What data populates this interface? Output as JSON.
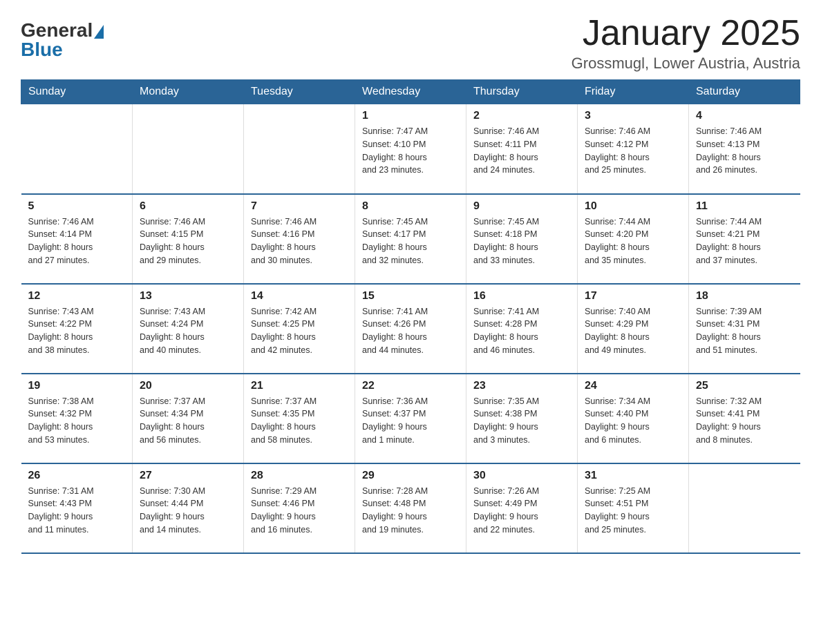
{
  "header": {
    "logo_general": "General",
    "logo_blue": "Blue",
    "title": "January 2025",
    "location": "Grossmugl, Lower Austria, Austria"
  },
  "days_of_week": [
    "Sunday",
    "Monday",
    "Tuesday",
    "Wednesday",
    "Thursday",
    "Friday",
    "Saturday"
  ],
  "weeks": [
    [
      {
        "day": "",
        "info": ""
      },
      {
        "day": "",
        "info": ""
      },
      {
        "day": "",
        "info": ""
      },
      {
        "day": "1",
        "info": "Sunrise: 7:47 AM\nSunset: 4:10 PM\nDaylight: 8 hours\nand 23 minutes."
      },
      {
        "day": "2",
        "info": "Sunrise: 7:46 AM\nSunset: 4:11 PM\nDaylight: 8 hours\nand 24 minutes."
      },
      {
        "day": "3",
        "info": "Sunrise: 7:46 AM\nSunset: 4:12 PM\nDaylight: 8 hours\nand 25 minutes."
      },
      {
        "day": "4",
        "info": "Sunrise: 7:46 AM\nSunset: 4:13 PM\nDaylight: 8 hours\nand 26 minutes."
      }
    ],
    [
      {
        "day": "5",
        "info": "Sunrise: 7:46 AM\nSunset: 4:14 PM\nDaylight: 8 hours\nand 27 minutes."
      },
      {
        "day": "6",
        "info": "Sunrise: 7:46 AM\nSunset: 4:15 PM\nDaylight: 8 hours\nand 29 minutes."
      },
      {
        "day": "7",
        "info": "Sunrise: 7:46 AM\nSunset: 4:16 PM\nDaylight: 8 hours\nand 30 minutes."
      },
      {
        "day": "8",
        "info": "Sunrise: 7:45 AM\nSunset: 4:17 PM\nDaylight: 8 hours\nand 32 minutes."
      },
      {
        "day": "9",
        "info": "Sunrise: 7:45 AM\nSunset: 4:18 PM\nDaylight: 8 hours\nand 33 minutes."
      },
      {
        "day": "10",
        "info": "Sunrise: 7:44 AM\nSunset: 4:20 PM\nDaylight: 8 hours\nand 35 minutes."
      },
      {
        "day": "11",
        "info": "Sunrise: 7:44 AM\nSunset: 4:21 PM\nDaylight: 8 hours\nand 37 minutes."
      }
    ],
    [
      {
        "day": "12",
        "info": "Sunrise: 7:43 AM\nSunset: 4:22 PM\nDaylight: 8 hours\nand 38 minutes."
      },
      {
        "day": "13",
        "info": "Sunrise: 7:43 AM\nSunset: 4:24 PM\nDaylight: 8 hours\nand 40 minutes."
      },
      {
        "day": "14",
        "info": "Sunrise: 7:42 AM\nSunset: 4:25 PM\nDaylight: 8 hours\nand 42 minutes."
      },
      {
        "day": "15",
        "info": "Sunrise: 7:41 AM\nSunset: 4:26 PM\nDaylight: 8 hours\nand 44 minutes."
      },
      {
        "day": "16",
        "info": "Sunrise: 7:41 AM\nSunset: 4:28 PM\nDaylight: 8 hours\nand 46 minutes."
      },
      {
        "day": "17",
        "info": "Sunrise: 7:40 AM\nSunset: 4:29 PM\nDaylight: 8 hours\nand 49 minutes."
      },
      {
        "day": "18",
        "info": "Sunrise: 7:39 AM\nSunset: 4:31 PM\nDaylight: 8 hours\nand 51 minutes."
      }
    ],
    [
      {
        "day": "19",
        "info": "Sunrise: 7:38 AM\nSunset: 4:32 PM\nDaylight: 8 hours\nand 53 minutes."
      },
      {
        "day": "20",
        "info": "Sunrise: 7:37 AM\nSunset: 4:34 PM\nDaylight: 8 hours\nand 56 minutes."
      },
      {
        "day": "21",
        "info": "Sunrise: 7:37 AM\nSunset: 4:35 PM\nDaylight: 8 hours\nand 58 minutes."
      },
      {
        "day": "22",
        "info": "Sunrise: 7:36 AM\nSunset: 4:37 PM\nDaylight: 9 hours\nand 1 minute."
      },
      {
        "day": "23",
        "info": "Sunrise: 7:35 AM\nSunset: 4:38 PM\nDaylight: 9 hours\nand 3 minutes."
      },
      {
        "day": "24",
        "info": "Sunrise: 7:34 AM\nSunset: 4:40 PM\nDaylight: 9 hours\nand 6 minutes."
      },
      {
        "day": "25",
        "info": "Sunrise: 7:32 AM\nSunset: 4:41 PM\nDaylight: 9 hours\nand 8 minutes."
      }
    ],
    [
      {
        "day": "26",
        "info": "Sunrise: 7:31 AM\nSunset: 4:43 PM\nDaylight: 9 hours\nand 11 minutes."
      },
      {
        "day": "27",
        "info": "Sunrise: 7:30 AM\nSunset: 4:44 PM\nDaylight: 9 hours\nand 14 minutes."
      },
      {
        "day": "28",
        "info": "Sunrise: 7:29 AM\nSunset: 4:46 PM\nDaylight: 9 hours\nand 16 minutes."
      },
      {
        "day": "29",
        "info": "Sunrise: 7:28 AM\nSunset: 4:48 PM\nDaylight: 9 hours\nand 19 minutes."
      },
      {
        "day": "30",
        "info": "Sunrise: 7:26 AM\nSunset: 4:49 PM\nDaylight: 9 hours\nand 22 minutes."
      },
      {
        "day": "31",
        "info": "Sunrise: 7:25 AM\nSunset: 4:51 PM\nDaylight: 9 hours\nand 25 minutes."
      },
      {
        "day": "",
        "info": ""
      }
    ]
  ]
}
